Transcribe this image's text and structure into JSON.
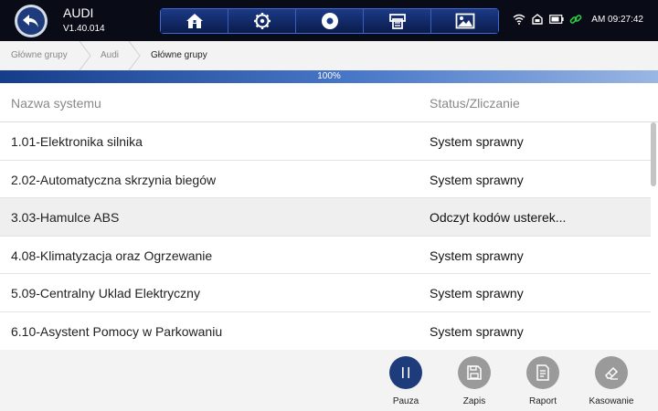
{
  "app": {
    "title": "AUDI",
    "version": "V1.40.014"
  },
  "topbar": {
    "nav_icons": [
      "home-icon",
      "gear-icon",
      "disc-icon",
      "printer-icon",
      "image-icon"
    ],
    "status_icons": [
      "wifi-icon",
      "vci-icon",
      "battery-icon",
      "link-icon"
    ],
    "time": "AM 09:27:42"
  },
  "breadcrumb": [
    "Główne grupy",
    "Audi",
    "Główne grupy"
  ],
  "progress": {
    "value": 1.0,
    "label": "100%"
  },
  "table": {
    "headers": {
      "name": "Nazwa systemu",
      "status": "Status/Zliczanie"
    },
    "rows": [
      {
        "name": "1.01-Elektronika silnika",
        "status": "System sprawny"
      },
      {
        "name": "2.02-Automatyczna skrzynia biegów",
        "status": "System sprawny"
      },
      {
        "name": "3.03-Hamulce ABS",
        "status": "Odczyt kodów usterek..."
      },
      {
        "name": "4.08-Klimatyzacja oraz Ogrzewanie",
        "status": "System sprawny"
      },
      {
        "name": "5.09-Centralny Uklad Elektryczny",
        "status": "System sprawny"
      },
      {
        "name": "6.10-Asystent Pomocy w Parkowaniu",
        "status": "System sprawny"
      }
    ],
    "selected_row": 2
  },
  "footer": {
    "pause": "Pauza",
    "save": "Zapis",
    "report": "Raport",
    "clear": "Kasowanie"
  },
  "colors": {
    "topbar": "#090c17",
    "accent": "#1e3c7c",
    "link_icon": "#2ecc40",
    "footer_disabled": "#9a9a9a"
  }
}
